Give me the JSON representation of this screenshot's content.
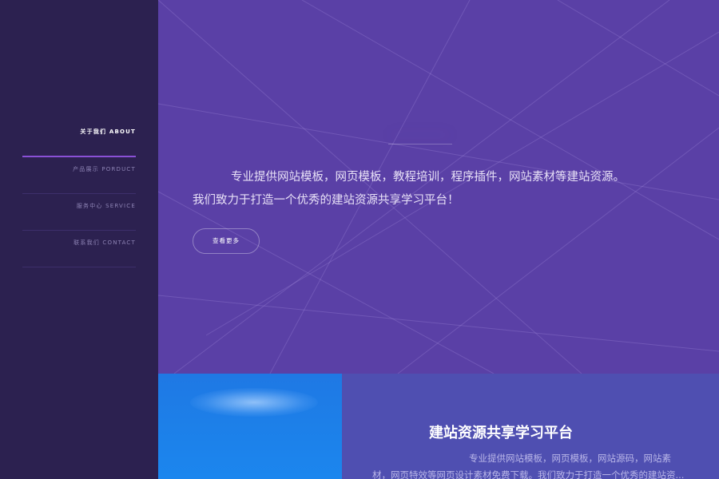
{
  "sidebar": {
    "items": [
      {
        "label": "关于我们 ABOUT",
        "active": true
      },
      {
        "label": "产品展示 PORDUCT",
        "active": false
      },
      {
        "label": "服务中心 SERVICE",
        "active": false
      },
      {
        "label": "联系我们 CONTACT",
        "active": false
      }
    ]
  },
  "hero": {
    "line1": "专业提供网站模板，网页模板，教程培训，程序插件，网站素材等建站资源。",
    "line2": "我们致力于打造一个优秀的建站资源共享学习平台！",
    "button_label": "查看更多"
  },
  "info": {
    "title": "建站资源共享学习平台",
    "desc_line1": "专业提供网站模板，网页模板，网站源码，网站素",
    "desc_line2": "材，网页特效等网页设计素材免费下载。我们致力于打造一个优秀的建站资..."
  },
  "colors": {
    "sidebar": "#2c2150",
    "hero": "#5a40a6",
    "accent": "#8a50d6",
    "photo": "#1d7fe8",
    "info": "#4f4fb1"
  }
}
